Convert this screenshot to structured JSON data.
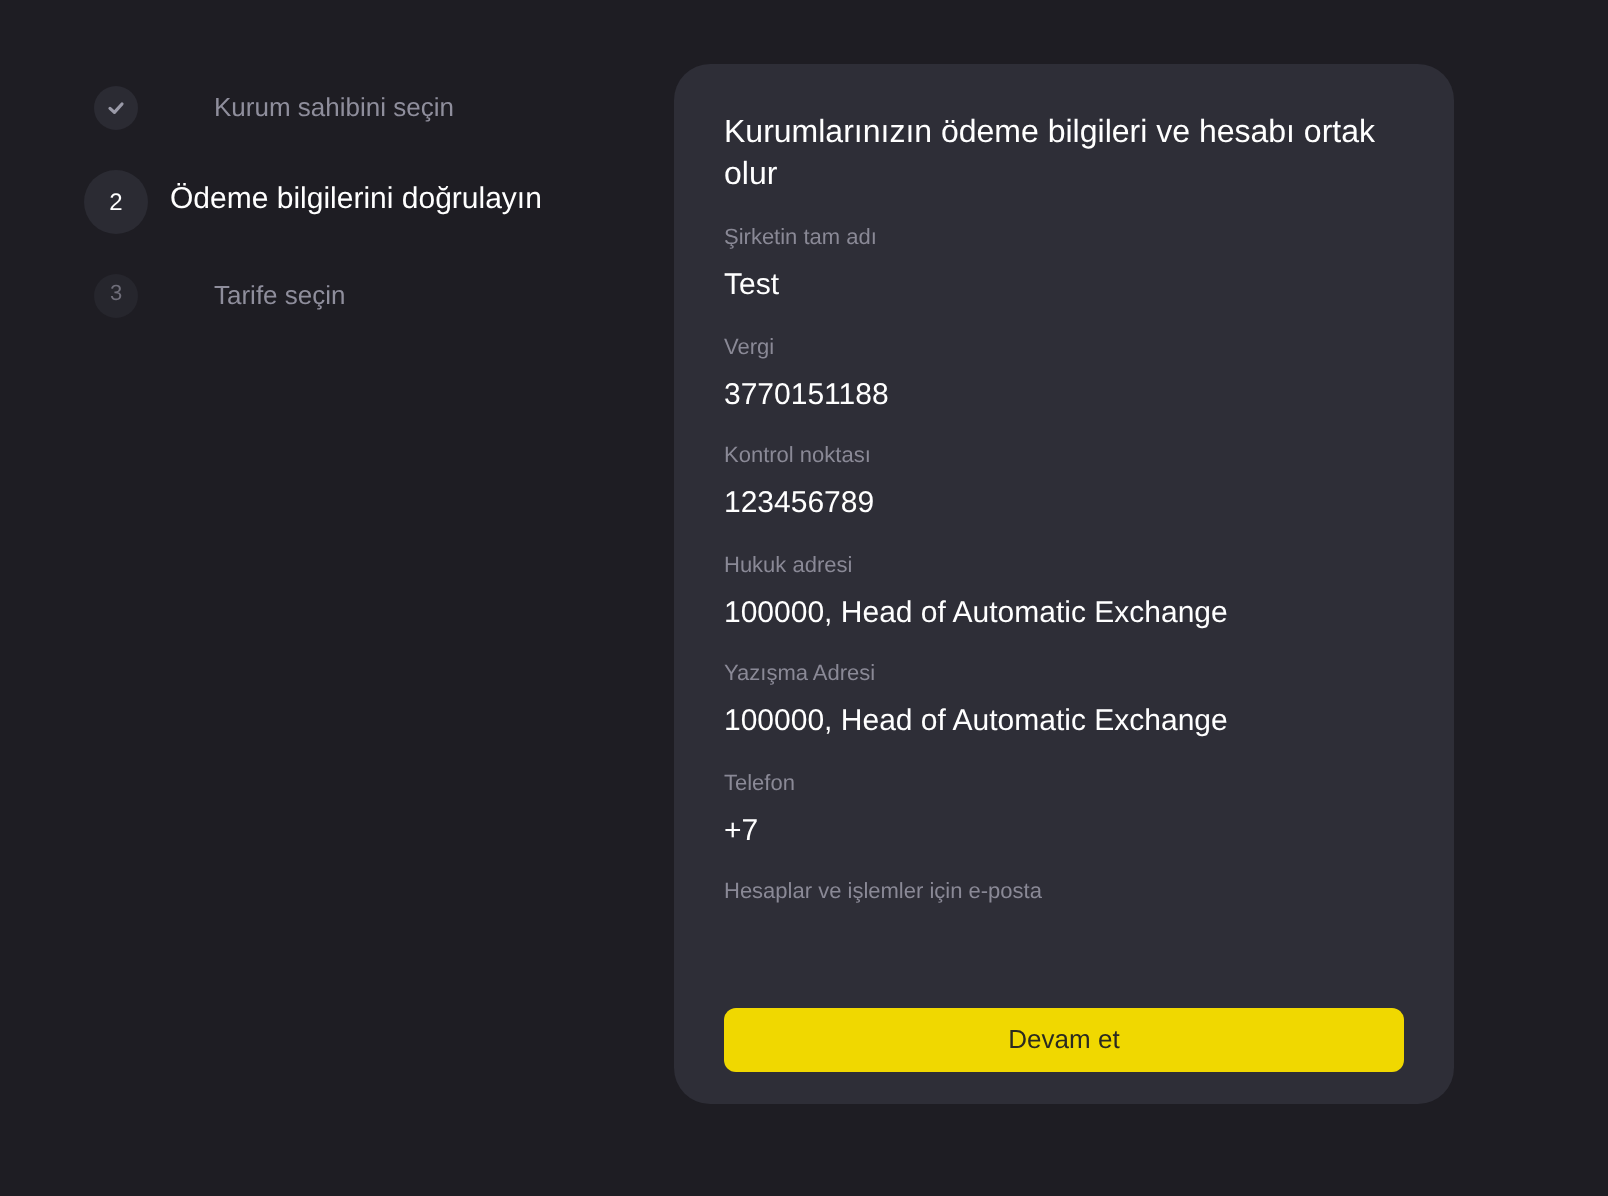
{
  "steps": [
    {
      "label": "Kurum sahibini seçin",
      "completed": true,
      "selected": false
    },
    {
      "number": "2",
      "label": "Ödeme bilgilerini doğrulayın",
      "completed": false,
      "selected": true
    },
    {
      "number": "3",
      "label": "Tarife seçin",
      "completed": false,
      "selected": false
    }
  ],
  "card": {
    "title": "Kurumlarınızın ödeme bilgileri ve hesabı ortak olur",
    "fields": [
      {
        "label": "Şirketin tam adı",
        "value": "Test"
      },
      {
        "label": "Vergi",
        "value": "3770151188"
      },
      {
        "label": "Kontrol noktası",
        "value": "123456789"
      },
      {
        "label": "Hukuk adresi",
        "value": "100000, Head of Automatic Exchange"
      },
      {
        "label": "Yazışma Adresi",
        "value": "100000, Head of Automatic Exchange"
      },
      {
        "label": "Telefon",
        "value": "+7"
      },
      {
        "label": "Hesaplar ve işlemler için e-posta"
      }
    ],
    "button": "Devam et"
  }
}
